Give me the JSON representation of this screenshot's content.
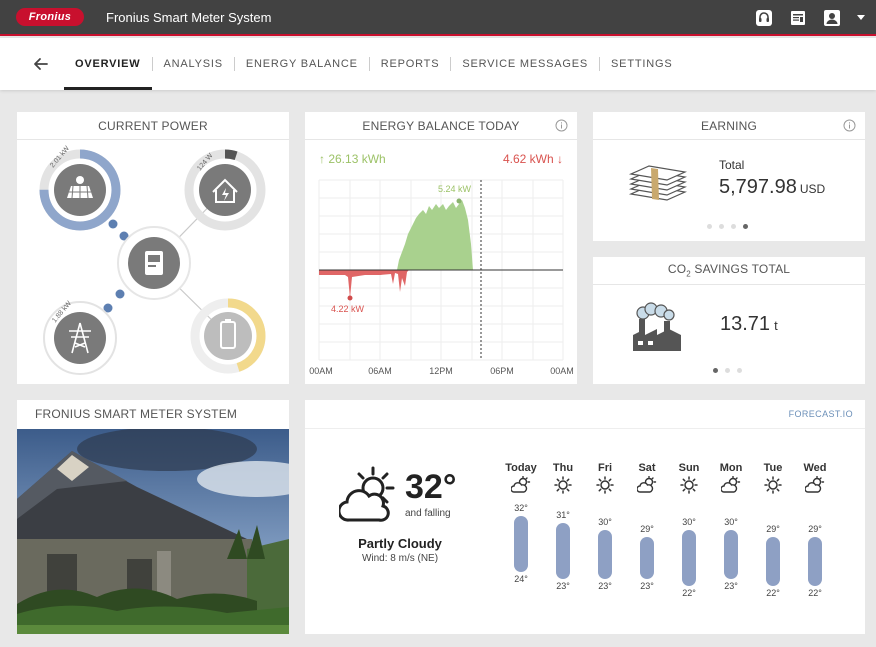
{
  "header": {
    "logo_text": "Fronius",
    "title": "Fronius Smart Meter System",
    "icons": [
      "support-icon",
      "calendar-report-icon",
      "user-account-icon",
      "caret-down-icon"
    ]
  },
  "nav": {
    "tabs": [
      "OVERVIEW",
      "ANALYSIS",
      "ENERGY BALANCE",
      "REPORTS",
      "SERVICE MESSAGES",
      "SETTINGS"
    ],
    "active": "OVERVIEW"
  },
  "current_power": {
    "title": "CURRENT POWER",
    "pv_label": "2.01 kW",
    "load_label": "124 W",
    "grid_label": "1.88 kW",
    "pv_fraction": 0.75,
    "load_fraction": 0.05,
    "battery_fraction": 0.45,
    "colors": {
      "pv_ring": "#8fa6cb",
      "battery_ring": "#f2d98c",
      "node": "#7a7a7a",
      "dot": "#5d7fb1"
    }
  },
  "energy_balance": {
    "title": "ENERGY BALANCE TODAY",
    "produced": "↑ 26.13 kWh",
    "consumed": "4.62 kWh ↓",
    "peak_label": "5.24 kW",
    "min_label": "4.22 kW",
    "x_ticks": [
      "00AM",
      "06AM",
      "12PM",
      "06PM",
      "00AM"
    ],
    "colors": {
      "production": "#a9d18e",
      "consumption": "#e06666"
    }
  },
  "earning": {
    "title": "EARNING",
    "label": "Total",
    "value": "5,797.98",
    "unit": "USD",
    "page_index": 3,
    "page_count": 4
  },
  "co2": {
    "title_prefix": "CO",
    "title_sub": "2",
    "title_suffix": " SAVINGS TOTAL",
    "value": "13.71",
    "unit": "t",
    "page_index": 0,
    "page_count": 3
  },
  "system": {
    "title": "FRONIUS SMART METER SYSTEM"
  },
  "weather": {
    "source": "FORECAST.IO",
    "temp": "32°",
    "trend": "and falling",
    "condition": "Partly Cloudy",
    "wind": "Wind: 8 m/s (NE)",
    "forecast": [
      {
        "day": "Today",
        "hi": "32°",
        "lo": "24°",
        "hi_n": 32,
        "lo_n": 24,
        "icon": "partly-cloudy-icon"
      },
      {
        "day": "Thu",
        "hi": "31°",
        "lo": "23°",
        "hi_n": 31,
        "lo_n": 23,
        "icon": "sun-icon"
      },
      {
        "day": "Fri",
        "hi": "30°",
        "lo": "23°",
        "hi_n": 30,
        "lo_n": 23,
        "icon": "sun-icon"
      },
      {
        "day": "Sat",
        "hi": "29°",
        "lo": "23°",
        "hi_n": 29,
        "lo_n": 23,
        "icon": "partly-cloudy-icon"
      },
      {
        "day": "Sun",
        "hi": "30°",
        "lo": "22°",
        "hi_n": 30,
        "lo_n": 22,
        "icon": "sun-icon"
      },
      {
        "day": "Mon",
        "hi": "30°",
        "lo": "23°",
        "hi_n": 30,
        "lo_n": 23,
        "icon": "partly-cloudy-icon"
      },
      {
        "day": "Tue",
        "hi": "29°",
        "lo": "22°",
        "hi_n": 29,
        "lo_n": 22,
        "icon": "sun-icon"
      },
      {
        "day": "Wed",
        "hi": "29°",
        "lo": "22°",
        "hi_n": 29,
        "lo_n": 22,
        "icon": "partly-cloudy-icon"
      }
    ]
  }
}
